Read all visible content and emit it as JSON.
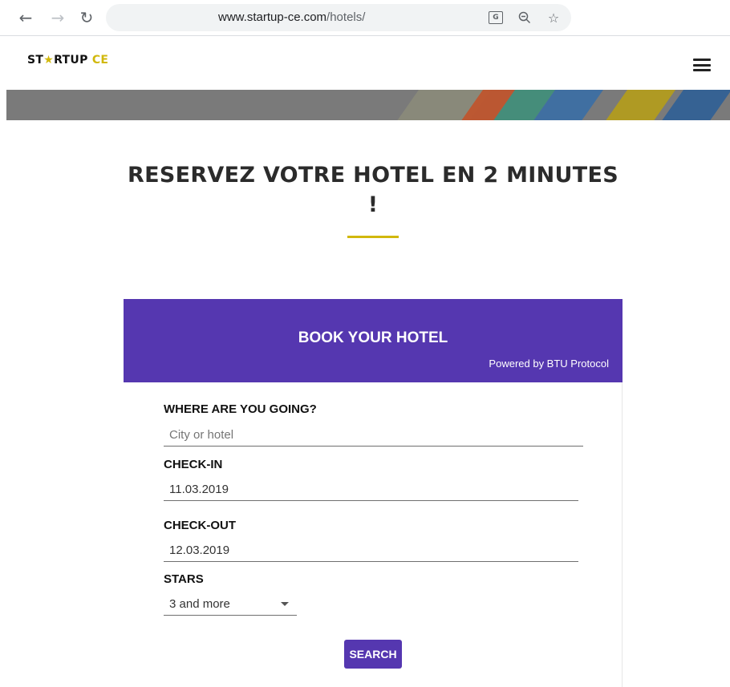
{
  "browser": {
    "url_domain": "www.startup-ce.com",
    "url_path": "/hotels/",
    "icons": [
      "back-arrow-icon",
      "forward-arrow-icon",
      "reload-icon",
      "translate-icon",
      "zoom-out-icon",
      "bookmark-star-icon"
    ]
  },
  "site": {
    "logo_prefix": "ST",
    "logo_star": "★",
    "logo_mid": "RTUP ",
    "logo_suffix": "CE",
    "menu_icon": "hamburger-menu-icon"
  },
  "page": {
    "headline_line1": "RESERVEZ VOTRE HOTEL EN 2 MINUTES",
    "headline_line2": "!"
  },
  "widget": {
    "title": "BOOK YOUR HOTEL",
    "powered_by": "Powered by BTU Protocol",
    "destination_label": "WHERE ARE YOU GOING?",
    "destination_placeholder": "City or hotel",
    "checkin_label": "CHECK-IN",
    "checkin_value": "11.03.2019",
    "checkout_label": "CHECK-OUT",
    "checkout_value": "12.03.2019",
    "stars_label": "STARS",
    "stars_value": "3 and more",
    "search_label": "SEARCH"
  },
  "colors": {
    "brand_purple": "#5537b0",
    "accent_yellow": "#d1b80c"
  }
}
